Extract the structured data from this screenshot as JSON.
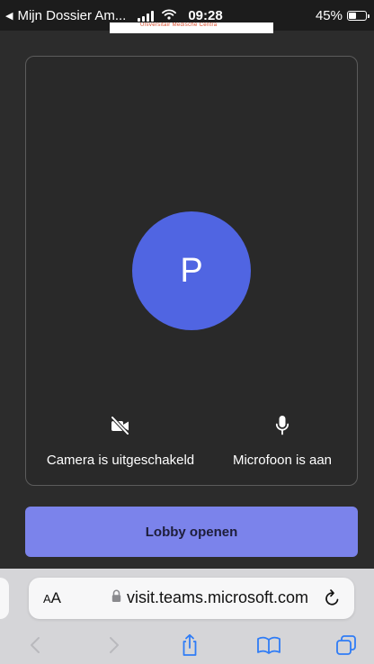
{
  "status_bar": {
    "back_label": "Mijn Dossier Am...",
    "time": "09:28",
    "battery_percent": "45%",
    "battery_level": 0.45
  },
  "logo": {
    "text": "Universitair Medische Centra"
  },
  "preview": {
    "avatar_initial": "P",
    "avatar_color": "#5065e2",
    "camera_label": "Camera is uitgeschakeld",
    "microphone_label": "Microfoon is aan",
    "camera_icon": "camera-off-icon",
    "microphone_icon": "microphone-icon"
  },
  "actions": {
    "lobby_button_label": "Lobby openen",
    "accent_color": "#7b83eb"
  },
  "browser": {
    "text_size_small": "A",
    "text_size_big": "A",
    "url": "visit.teams.microsoft.com",
    "lock_icon": "lock-icon",
    "reload_icon": "reload-icon",
    "toolbar_icons": [
      "back-arrow-icon",
      "forward-arrow-icon",
      "share-icon",
      "bookmarks-icon",
      "tabs-icon"
    ]
  }
}
